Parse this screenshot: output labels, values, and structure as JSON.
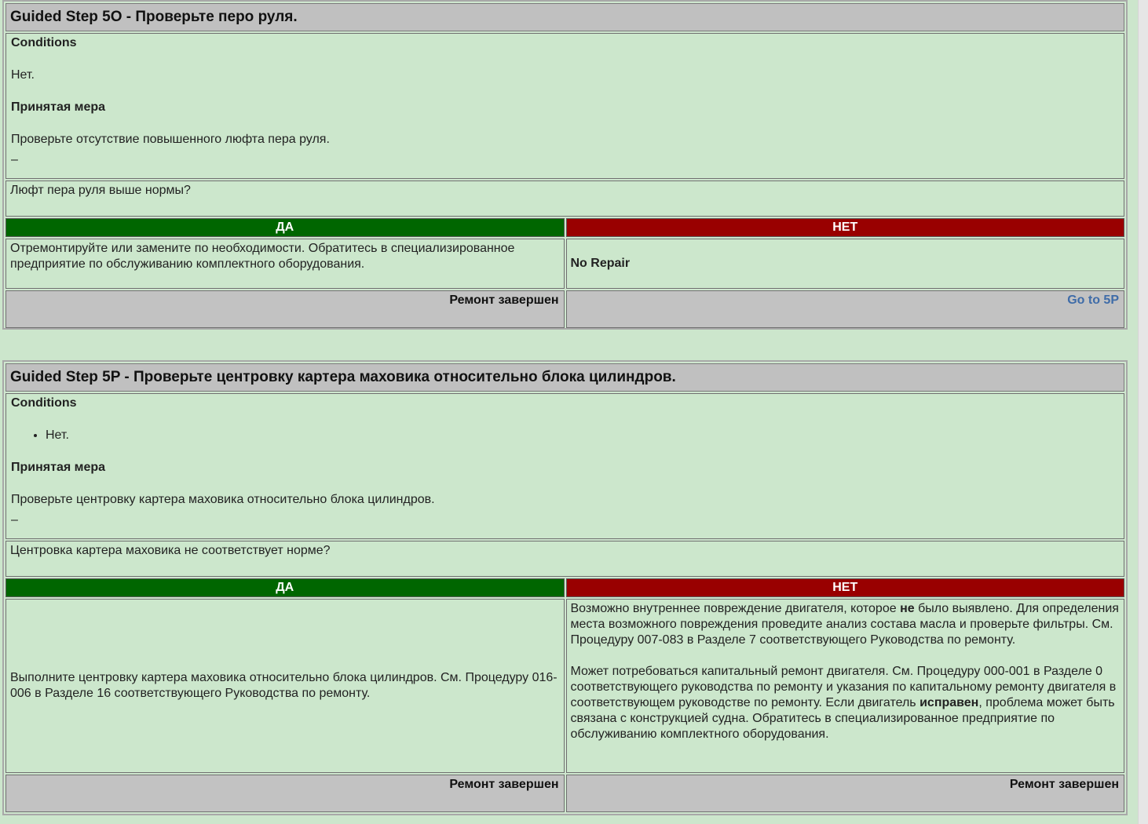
{
  "steps": [
    {
      "title": "Guided Step 5O - Проверьте перо руля.",
      "conditions_heading": "Conditions",
      "conditions_text": "Нет.",
      "action_heading": "Принятая мера",
      "action_text": "Проверьте отсутствие повышенного люфта пера руля.",
      "dash": "–",
      "question": "Люфт пера руля выше нормы?",
      "yes_label": "ДА",
      "no_label": "НЕТ",
      "yes_text": "Отремонтируйте или замените по необходимости. Обратитесь в специализированное предприятие по обслуживанию комплектного оборудования.",
      "no_text": "No Repair",
      "yes_footer": "Ремонт завершен",
      "no_footer_link": "Go to 5P"
    },
    {
      "title": "Guided Step 5P - Проверьте центровку картера маховика относительно блока цилиндров.",
      "conditions_heading": "Conditions",
      "conditions_item": "Нет.",
      "action_heading": "Принятая мера",
      "action_text": "Проверьте центровку картера маховика относительно блока цилиндров.",
      "dash": "–",
      "question": "Центровка картера маховика не соответствует норме?",
      "yes_label": "ДА",
      "no_label": "НЕТ",
      "yes_text": "Выполните центровку картера маховика относительно блока цилиндров. См. Процедуру 016-006 в Разделе 16 соответствующего Руководства по ремонту.",
      "no_para1_a": "Возможно внутреннее повреждение двигателя, которое ",
      "no_para1_bold": "не",
      "no_para1_b": " было выявлено. Для определения места возможного повреждения проведите анализ состава масла и проверьте фильтры. См. Процедуру 007-083 в Разделе 7 соответствующего Руководства по ремонту.",
      "no_para2_a": "Может потребоваться капитальный ремонт двигателя. См. Процедуру 000-001 в Разделе 0 соответствующего руководства по ремонту и указания по капитальному ремонту двигателя в соответствующем руководстве по ремонту. Если двигатель ",
      "no_para2_bold": "исправен",
      "no_para2_b": ", проблема может быть связана с конструкцией судна. Обратитесь в специализированное предприятие по обслуживанию комплектного оборудования.",
      "yes_footer": "Ремонт завершен",
      "no_footer": "Ремонт завершен"
    }
  ]
}
